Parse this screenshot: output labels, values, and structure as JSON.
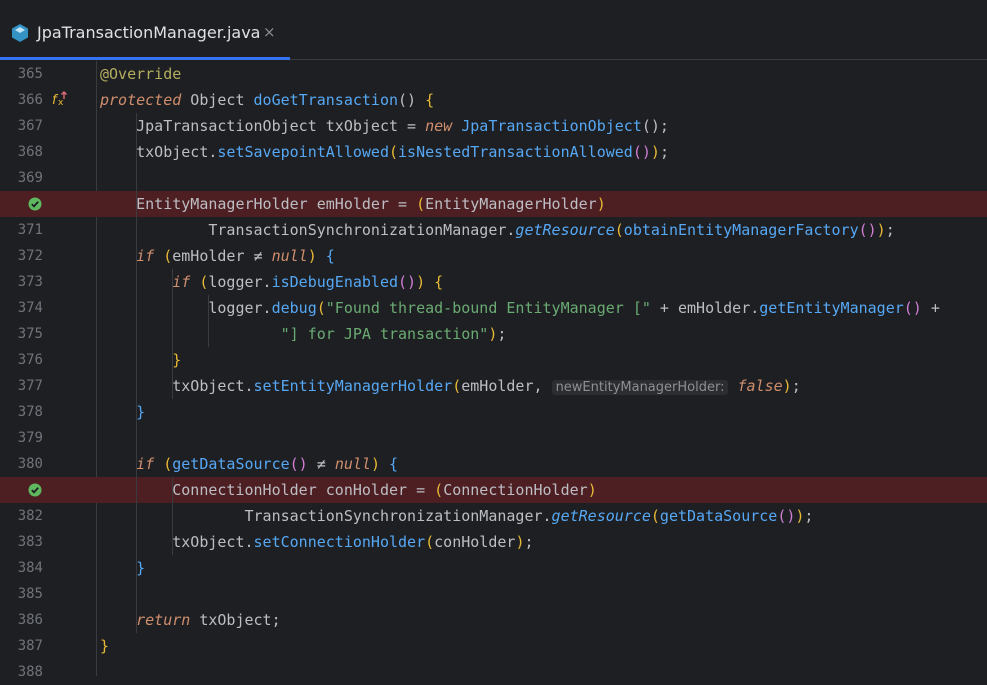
{
  "tab": {
    "label": "JpaTransactionManager.java",
    "close": "×",
    "icon": "java-class-icon"
  },
  "colors": {
    "accent": "#3574f0",
    "breakpoint_line": "#4e1f22",
    "breakpoint_icon": "#5fb85f"
  },
  "lines": [
    {
      "n": "365",
      "icon": null
    },
    {
      "n": "366",
      "icon": "override-method-icon"
    },
    {
      "n": "367",
      "icon": null
    },
    {
      "n": "368",
      "icon": null
    },
    {
      "n": "369",
      "icon": null
    },
    {
      "n": "",
      "icon": "breakpoint-verified-icon"
    },
    {
      "n": "371",
      "icon": null
    },
    {
      "n": "372",
      "icon": null
    },
    {
      "n": "373",
      "icon": null
    },
    {
      "n": "374",
      "icon": null
    },
    {
      "n": "375",
      "icon": null
    },
    {
      "n": "376",
      "icon": null
    },
    {
      "n": "377",
      "icon": null
    },
    {
      "n": "378",
      "icon": null
    },
    {
      "n": "379",
      "icon": null
    },
    {
      "n": "380",
      "icon": null
    },
    {
      "n": "",
      "icon": "breakpoint-verified-icon"
    },
    {
      "n": "382",
      "icon": null
    },
    {
      "n": "383",
      "icon": null
    },
    {
      "n": "384",
      "icon": null
    },
    {
      "n": "385",
      "icon": null
    },
    {
      "n": "386",
      "icon": null
    },
    {
      "n": "387",
      "icon": null
    },
    {
      "n": "388",
      "icon": null
    }
  ],
  "code": {
    "l365": [
      [
        "an",
        "@Override"
      ]
    ],
    "l366": [
      [
        "ki",
        "protected"
      ],
      [
        "cl",
        " Object "
      ],
      [
        "fn",
        "doGetTransaction"
      ],
      [
        "cl",
        "() "
      ],
      [
        "pa1",
        "{"
      ]
    ],
    "l367": [
      [
        "cl",
        "    JpaTransactionObject "
      ],
      [
        "lv",
        "txObject"
      ],
      [
        "cl",
        " = "
      ],
      [
        "ki",
        "new"
      ],
      [
        "cl",
        " "
      ],
      [
        "fn",
        "JpaTransactionObject"
      ],
      [
        "cl",
        "();"
      ]
    ],
    "l368": [
      [
        "cl",
        "    txObject."
      ],
      [
        "fn",
        "setSavepointAllowed"
      ],
      [
        "pa1",
        "("
      ],
      [
        "fn",
        "isNestedTransactionAllowed"
      ],
      [
        "pa2",
        "()"
      ],
      [
        "pa1",
        ")"
      ],
      [
        "cl",
        ";"
      ]
    ],
    "l369": [],
    "l370": [
      [
        "cl",
        "    EntityManagerHolder "
      ],
      [
        "lv",
        "emHolder"
      ],
      [
        "cl",
        " = "
      ],
      [
        "pa1",
        "("
      ],
      [
        "cl",
        "EntityManagerHolder"
      ],
      [
        "pa1",
        ")"
      ]
    ],
    "l371": [
      [
        "cl",
        "            TransactionSynchronizationManager."
      ],
      [
        "fi",
        "getResource"
      ],
      [
        "pa1",
        "("
      ],
      [
        "fn",
        "obtainEntityManagerFactory"
      ],
      [
        "pa2",
        "()"
      ],
      [
        "pa1",
        ")"
      ],
      [
        "cl",
        ";"
      ]
    ],
    "l372": [
      [
        "ki",
        "    if"
      ],
      [
        "cl",
        " "
      ],
      [
        "pa1",
        "("
      ],
      [
        "cl",
        "emHolder ≠ "
      ],
      [
        "ki",
        "null"
      ],
      [
        "pa1",
        ")"
      ],
      [
        "cl",
        " "
      ],
      [
        "pa3",
        "{"
      ]
    ],
    "l373": [
      [
        "ki",
        "        if"
      ],
      [
        "cl",
        " "
      ],
      [
        "pa1",
        "("
      ],
      [
        "cl",
        "logger."
      ],
      [
        "fn",
        "isDebugEnabled"
      ],
      [
        "pa2",
        "()"
      ],
      [
        "pa1",
        ")"
      ],
      [
        "cl",
        " "
      ],
      [
        "pa1",
        "{"
      ]
    ],
    "l374": [
      [
        "cl",
        "            logger."
      ],
      [
        "fn",
        "debug"
      ],
      [
        "pa1",
        "("
      ],
      [
        "st",
        "\"Found thread-bound EntityManager [\""
      ],
      [
        "cl",
        " + emHolder."
      ],
      [
        "fn",
        "getEntityManager"
      ],
      [
        "pa2",
        "()"
      ],
      [
        "cl",
        " +"
      ]
    ],
    "l375": [
      [
        "st",
        "                    \"] for JPA transaction\""
      ],
      [
        "pa1",
        ")"
      ],
      [
        "cl",
        ";"
      ]
    ],
    "l376": [
      [
        "pa1",
        "        }"
      ]
    ],
    "l377": [
      [
        "cl",
        "        txObject."
      ],
      [
        "fn",
        "setEntityManagerHolder"
      ],
      [
        "pa1",
        "("
      ],
      [
        "cl",
        "emHolder, "
      ],
      [
        "hint",
        "newEntityManagerHolder:"
      ],
      [
        "cl",
        " "
      ],
      [
        "ki",
        "false"
      ],
      [
        "pa1",
        ")"
      ],
      [
        "cl",
        ";"
      ]
    ],
    "l378": [
      [
        "pa3",
        "    }"
      ]
    ],
    "l379": [],
    "l380": [
      [
        "ki",
        "    if"
      ],
      [
        "cl",
        " "
      ],
      [
        "pa1",
        "("
      ],
      [
        "fn",
        "getDataSource"
      ],
      [
        "pa2",
        "()"
      ],
      [
        "cl",
        " ≠ "
      ],
      [
        "ki",
        "null"
      ],
      [
        "pa1",
        ")"
      ],
      [
        "cl",
        " "
      ],
      [
        "pa3",
        "{"
      ]
    ],
    "l381": [
      [
        "cl",
        "        ConnectionHolder "
      ],
      [
        "lv",
        "conHolder"
      ],
      [
        "cl",
        " = "
      ],
      [
        "pa1",
        "("
      ],
      [
        "cl",
        "ConnectionHolder"
      ],
      [
        "pa1",
        ")"
      ]
    ],
    "l382": [
      [
        "cl",
        "                TransactionSynchronizationManager."
      ],
      [
        "fi",
        "getResource"
      ],
      [
        "pa1",
        "("
      ],
      [
        "fn",
        "getDataSource"
      ],
      [
        "pa2",
        "()"
      ],
      [
        "pa1",
        ")"
      ],
      [
        "cl",
        ";"
      ]
    ],
    "l383": [
      [
        "cl",
        "        txObject."
      ],
      [
        "fn",
        "setConnectionHolder"
      ],
      [
        "pa1",
        "("
      ],
      [
        "cl",
        "conHolder"
      ],
      [
        "pa1",
        ")"
      ],
      [
        "cl",
        ";"
      ]
    ],
    "l384": [
      [
        "pa3",
        "    }"
      ]
    ],
    "l385": [],
    "l386": [
      [
        "ki",
        "    return"
      ],
      [
        "cl",
        " txObject;"
      ]
    ],
    "l387": [
      [
        "pa1",
        "}"
      ]
    ],
    "l388": []
  }
}
